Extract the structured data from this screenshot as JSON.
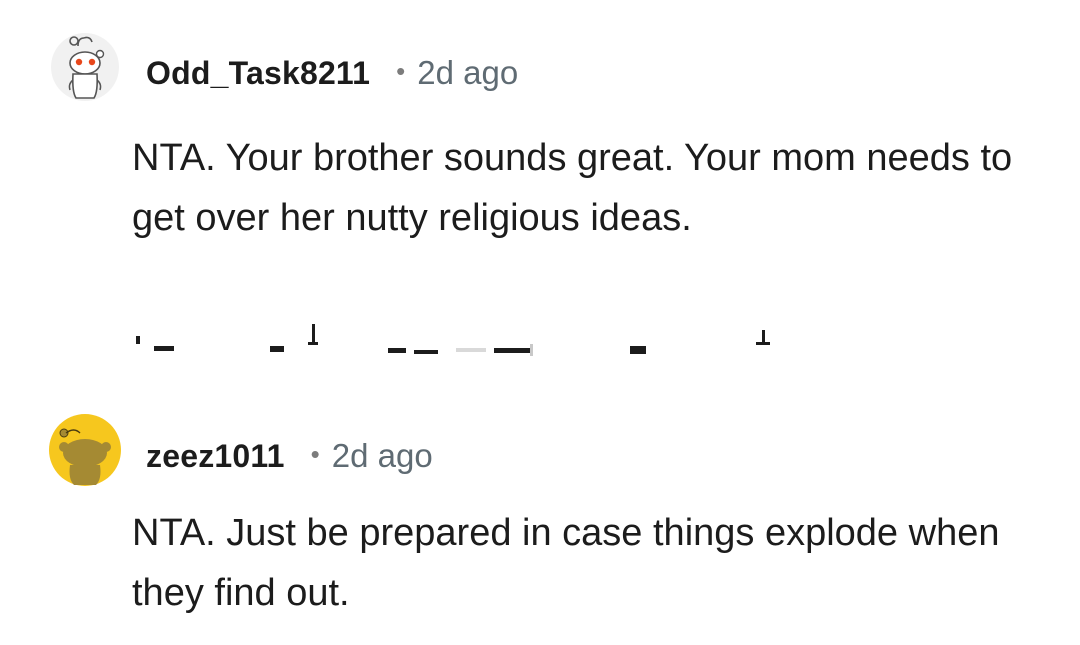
{
  "comments": [
    {
      "username": "Odd_Task8211",
      "separator": "•",
      "timestamp": "2d ago",
      "text": "NTA. Your brother sounds great. Your mom needs to get over her nutty religious ideas.",
      "avatar_icon": "snoo-avatar-white-icon"
    },
    {
      "username": "zeez1011",
      "separator": "•",
      "timestamp": "2d ago",
      "text": "NTA. Just be prepared in case things explode when they find out.",
      "avatar_icon": "snoo-avatar-yellow-icon"
    }
  ],
  "colors": {
    "text": "#1c1c1c",
    "meta": "#5f6b73",
    "avatar_yellow": "#f6c71e",
    "avatar_olive": "#a58a33"
  }
}
